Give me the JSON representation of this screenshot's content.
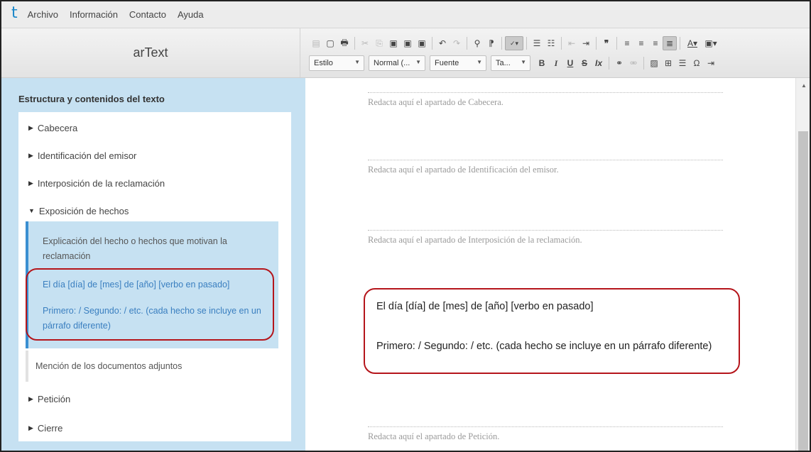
{
  "menu": {
    "logo": "t",
    "items": [
      "Archivo",
      "Información",
      "Contacto",
      "Ayuda"
    ]
  },
  "app_title": "arText",
  "toolbar": {
    "row2": {
      "style": "Estilo",
      "format": "Normal (...",
      "font": "Fuente",
      "size": "Ta...",
      "bold": "B",
      "italic": "I",
      "underline": "U",
      "strike": "S"
    },
    "icons_row1": [
      "save-icon",
      "new-document-icon",
      "print-icon",
      "cut-icon",
      "copy-icon",
      "paste-icon",
      "paste-text-icon",
      "paste-word-icon",
      "undo-icon",
      "redo-icon",
      "find-icon",
      "select-all-icon",
      "spellcheck-icon",
      "numbered-list-icon",
      "bulleted-list-icon",
      "outdent-icon",
      "indent-icon",
      "blockquote-icon",
      "align-left-icon",
      "align-center-icon",
      "align-right-icon",
      "justify-icon",
      "text-color-icon",
      "background-color-icon"
    ]
  },
  "sidebar": {
    "heading": "Estructura y contenidos del texto",
    "sections": [
      {
        "label": "Cabecera",
        "expanded": false
      },
      {
        "label": "Identificación del emisor",
        "expanded": false
      },
      {
        "label": "Interposición de la reclamación",
        "expanded": false
      },
      {
        "label": "Exposición de hechos",
        "expanded": true
      },
      {
        "label": "Petición",
        "expanded": false
      },
      {
        "label": "Cierre",
        "expanded": false
      }
    ],
    "subsections": {
      "explanation": "Explicación del hecho o hechos que motivan la reclamación",
      "template_1": "El día [día] de [mes] de [año] [verbo en pasado]",
      "template_2": "Primero: / Segundo: / etc. (cada hecho se incluye en un párrafo diferente)",
      "mention": "Mención de los documentos adjuntos"
    }
  },
  "editor": {
    "placeholders": [
      "Redacta aquí el apartado de Cabecera.",
      "Redacta aquí el apartado de Identificación del emisor.",
      "Redacta aquí el apartado de Interposición de la reclamación.",
      "Redacta aquí el apartado de Petición."
    ],
    "content_line1": "El día [día] de [mes] de [año] [verbo en pasado]",
    "content_line2": "Primero: / Segundo: / etc. (cada hecho se incluye en un párrafo diferente)"
  },
  "colors": {
    "accent": "#1b87c9",
    "sidebar_bg": "#c6e1f2",
    "highlight_border": "#b5151b",
    "link": "#3a7fc0"
  }
}
